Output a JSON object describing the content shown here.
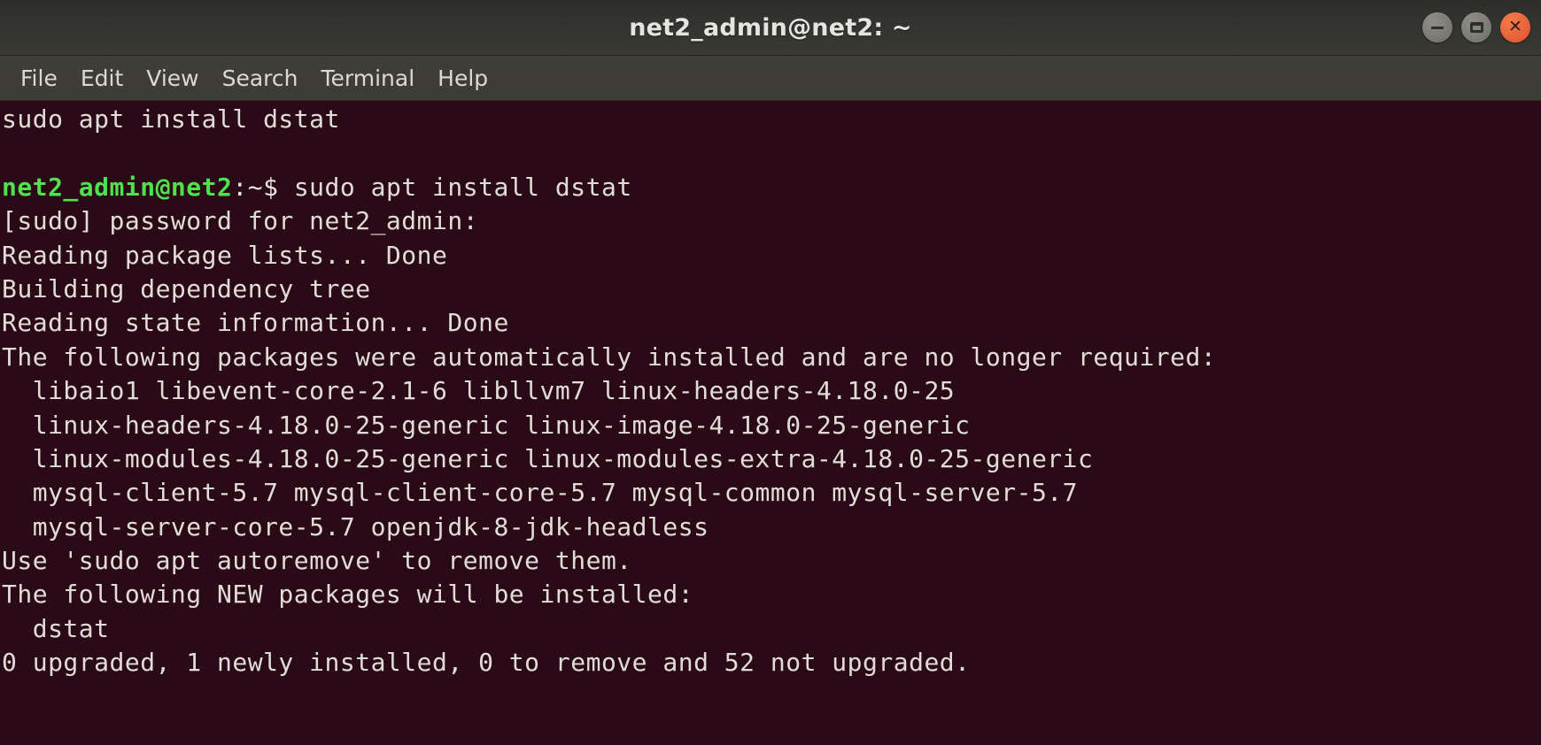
{
  "window": {
    "title": "net2_admin@net2: ~",
    "controls": [
      {
        "name": "minimize",
        "glyph": "–"
      },
      {
        "name": "maximize",
        "glyph": "□"
      },
      {
        "name": "close",
        "glyph": "✕"
      }
    ]
  },
  "menubar": {
    "items": [
      {
        "label": "File"
      },
      {
        "label": "Edit"
      },
      {
        "label": "View"
      },
      {
        "label": "Search"
      },
      {
        "label": "Terminal"
      },
      {
        "label": "Help"
      }
    ]
  },
  "terminal": {
    "colors": {
      "background": "#2a0a17",
      "foreground": "#e2dcd8",
      "prompt_green": "#4ee24e",
      "titlebar": "#343430",
      "menubar": "#3e3e37",
      "close_button": "#e4512a"
    },
    "lines": [
      {
        "text": "sudo apt install dstat"
      },
      {
        "text": ""
      },
      {
        "prompt_user": "net2_admin@net2",
        "prompt_tail": ":~$ ",
        "command": "sudo apt install dstat"
      },
      {
        "text": "[sudo] password for net2_admin:"
      },
      {
        "text": "Reading package lists... Done"
      },
      {
        "text": "Building dependency tree"
      },
      {
        "text": "Reading state information... Done"
      },
      {
        "text": "The following packages were automatically installed and are no longer required:"
      },
      {
        "text": "  libaio1 libevent-core-2.1-6 libllvm7 linux-headers-4.18.0-25"
      },
      {
        "text": "  linux-headers-4.18.0-25-generic linux-image-4.18.0-25-generic"
      },
      {
        "text": "  linux-modules-4.18.0-25-generic linux-modules-extra-4.18.0-25-generic"
      },
      {
        "text": "  mysql-client-5.7 mysql-client-core-5.7 mysql-common mysql-server-5.7"
      },
      {
        "text": "  mysql-server-core-5.7 openjdk-8-jdk-headless"
      },
      {
        "text": "Use 'sudo apt autoremove' to remove them."
      },
      {
        "text": "The following NEW packages will be installed:"
      },
      {
        "text": "  dstat"
      },
      {
        "text": "0 upgraded, 1 newly installed, 0 to remove and 52 not upgraded."
      }
    ]
  }
}
